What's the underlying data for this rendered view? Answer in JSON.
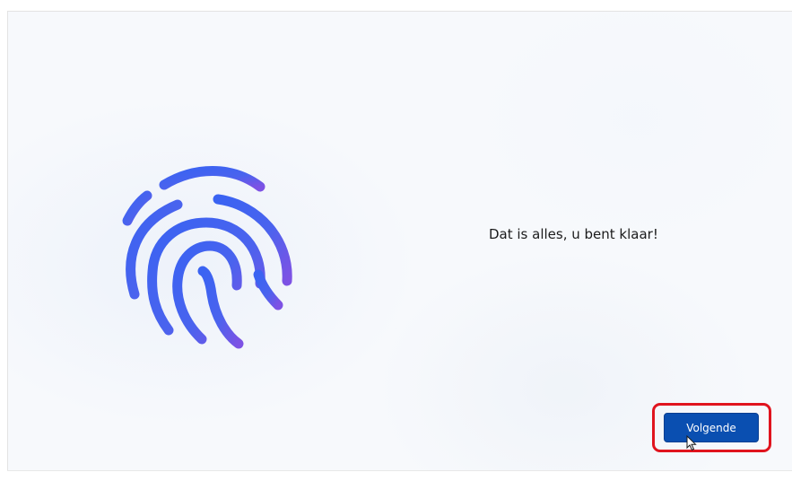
{
  "screen": {
    "message": "Dat is alles, u bent klaar!",
    "next_button_label": "Volgende"
  },
  "icons": {
    "illustration": "fingerprint-icon",
    "pointer": "mouse-cursor-icon"
  },
  "colors": {
    "button_bg": "#0a4fb1",
    "highlight_border": "#e0141e",
    "fingerprint_start": "#3b6cf0",
    "fingerprint_end": "#7a55e6"
  }
}
